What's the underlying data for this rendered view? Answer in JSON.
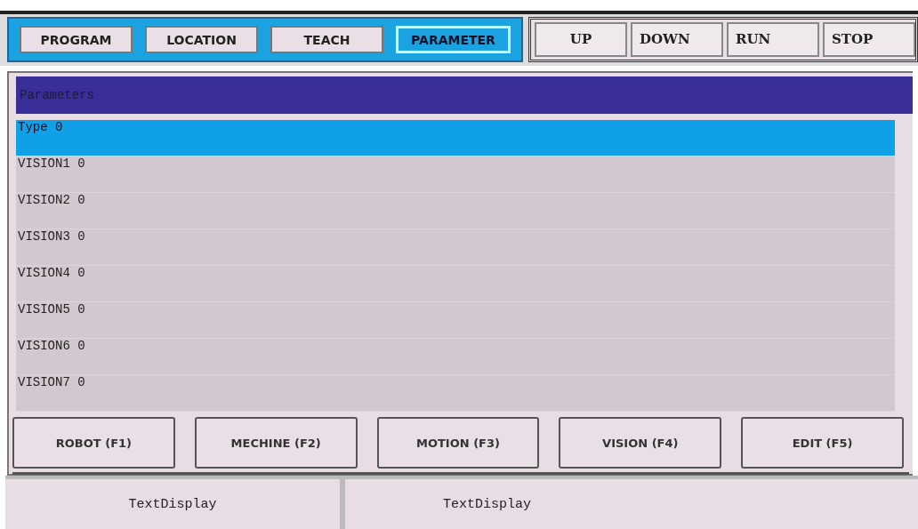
{
  "tabs": [
    {
      "label": "PROGRAM",
      "selected": false
    },
    {
      "label": "LOCATION",
      "selected": false
    },
    {
      "label": "TEACH",
      "selected": false
    },
    {
      "label": "PARAMETER",
      "selected": true
    }
  ],
  "controls": [
    "UP",
    "DOWN",
    "RUN",
    "STOP"
  ],
  "panel": {
    "title": "Parameters",
    "rows": [
      {
        "text": "Type 0",
        "selected": true
      },
      {
        "text": "VISION1 0",
        "selected": false
      },
      {
        "text": "VISION2 0",
        "selected": false
      },
      {
        "text": "VISION3 0",
        "selected": false
      },
      {
        "text": "VISION4 0",
        "selected": false
      },
      {
        "text": "VISION5 0",
        "selected": false
      },
      {
        "text": "VISION6 0",
        "selected": false
      },
      {
        "text": "VISION7 0",
        "selected": false
      }
    ]
  },
  "function_buttons": [
    "ROBOT (F1)",
    "MECHINE (F2)",
    "MOTION (F3)",
    "VISION (F4)",
    "EDIT (F5)"
  ],
  "status_bar": [
    "TextDisplay",
    "TextDisplay"
  ]
}
